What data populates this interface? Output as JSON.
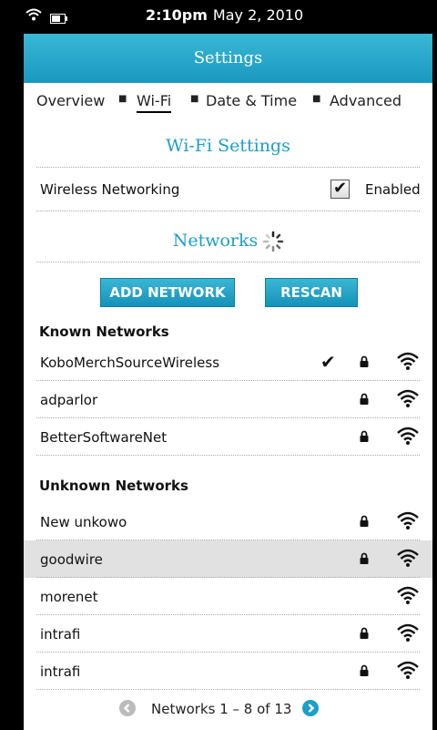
{
  "status": {
    "time": "2:10pm",
    "date": "May 2, 2010",
    "wifi_icon": "wifi-icon",
    "battery_icon": "battery-icon"
  },
  "header": {
    "title": "Settings"
  },
  "tabs": [
    {
      "label": "Overview",
      "active": false
    },
    {
      "label": "Wi-Fi",
      "active": true
    },
    {
      "label": "Date & Time",
      "active": false
    },
    {
      "label": "Advanced",
      "active": false
    }
  ],
  "wifi_settings": {
    "title": "Wi-Fi Settings",
    "wireless_label": "Wireless Networking",
    "wireless_checked": true,
    "wireless_state": "Enabled"
  },
  "networks": {
    "title": "Networks",
    "add_button": "ADD NETWORK",
    "rescan_button": "RESCAN",
    "known_heading": "Known Networks",
    "known": [
      {
        "name": "KoboMerchSourceWireless",
        "connected": true,
        "locked": true
      },
      {
        "name": "adparlor",
        "connected": false,
        "locked": true
      },
      {
        "name": "BetterSoftwareNet",
        "connected": false,
        "locked": true
      }
    ],
    "unknown_heading": "Unknown Networks",
    "unknown": [
      {
        "name": "New unkowo",
        "locked": true,
        "highlight": false
      },
      {
        "name": "goodwire",
        "locked": true,
        "highlight": true
      },
      {
        "name": "morenet",
        "locked": false,
        "highlight": false
      },
      {
        "name": "intrafi",
        "locked": true,
        "highlight": false
      },
      {
        "name": "intrafi",
        "locked": true,
        "highlight": false
      }
    ]
  },
  "pager": {
    "text": "Networks 1 – 8 of 13"
  },
  "colors": {
    "accent": "#1c9fc6",
    "highlight_row": "#e1e1e1"
  }
}
